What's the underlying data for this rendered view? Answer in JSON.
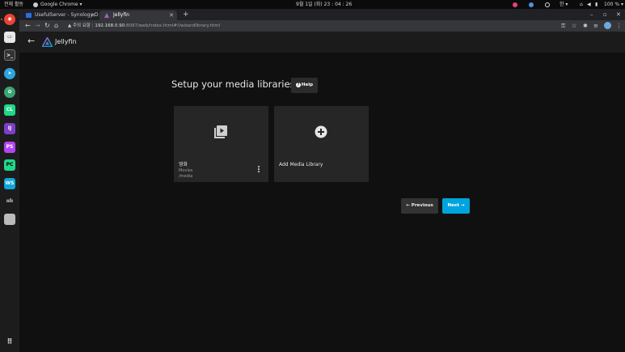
{
  "system_bar": {
    "activities": "전체 활동",
    "app_name": "Google Chrome ▾",
    "clock": "9월 1일 (화)  23 : 04 : 26",
    "input_method": "한 ▾",
    "battery": "100 % ▾"
  },
  "dock": {
    "apps": [
      "chrome",
      "files",
      "terminal",
      "telegram",
      "krita",
      "clion",
      "intellij",
      "phpstorm",
      "pycharm",
      "webstorm",
      "vlc",
      "trash"
    ],
    "grid_icon": "apps-grid-icon"
  },
  "browser": {
    "tabs": [
      {
        "label": "UsefulServer - Synology D",
        "active": false
      },
      {
        "label": "Jellyfin",
        "active": true
      }
    ],
    "new_tab": "+",
    "address": {
      "security_label": "주의 요함",
      "host": "192.168.0.90",
      "path": ":8097/web/index.html#!/wizardlibrary.html"
    }
  },
  "jellyfin": {
    "brand": "Jellyfin",
    "title": "Setup your media libraries",
    "help_label": "Help",
    "libraries": [
      {
        "name": "영화",
        "type": "Movies",
        "path": "/media"
      }
    ],
    "add_label": "Add Media Library",
    "previous_label": "← Previous",
    "next_label": "Next →"
  },
  "colors": {
    "accent": "#00a4dc",
    "card": "#262626",
    "background": "#101010"
  }
}
